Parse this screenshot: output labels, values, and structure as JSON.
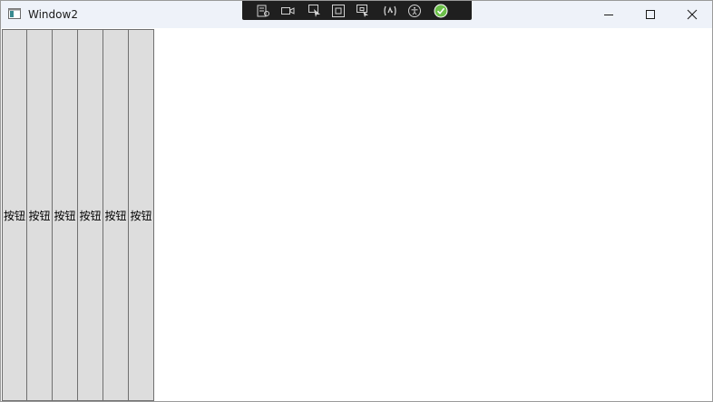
{
  "window": {
    "title": "Window2"
  },
  "titlebar": {
    "icons": {
      "app": "app-window-icon",
      "minimize": "minimize-icon",
      "maximize": "maximize-icon",
      "close": "close-icon"
    }
  },
  "debug_toolbar": {
    "icons": [
      "live-visual-tree-icon",
      "video-record-icon",
      "select-element-icon",
      "display-layout-adorners-icon",
      "track-focused-element-icon",
      "hot-reload-icon",
      "accessibility-icon",
      "check-status-icon"
    ]
  },
  "buttons": [
    {
      "label": "按钮"
    },
    {
      "label": "按钮"
    },
    {
      "label": "按钮"
    },
    {
      "label": "按钮"
    },
    {
      "label": "按钮"
    },
    {
      "label": "按钮"
    }
  ],
  "colors": {
    "titlebar_bg": "#eef2f9",
    "button_bg": "#dddddd",
    "button_border": "#707070",
    "devbar_bg": "#1f1f1f",
    "status_green": "#6cc04a"
  }
}
